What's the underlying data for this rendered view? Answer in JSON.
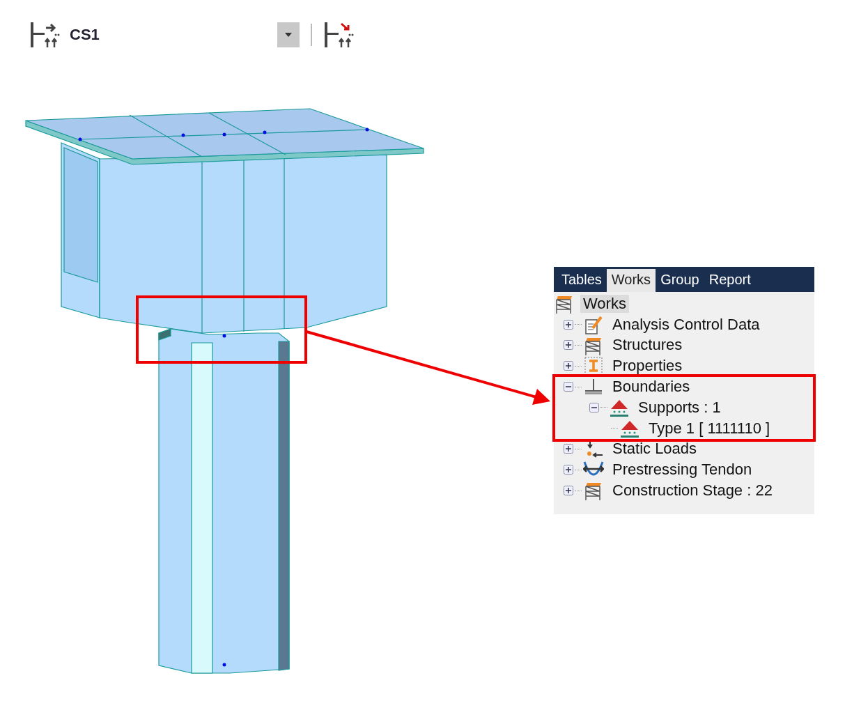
{
  "toolbar": {
    "stage": "CS1"
  },
  "panel": {
    "tabs": [
      {
        "label": "Tables",
        "selected": false
      },
      {
        "label": "Works",
        "selected": true
      },
      {
        "label": "Group",
        "selected": false
      },
      {
        "label": "Report",
        "selected": false
      }
    ],
    "tree": [
      {
        "label": "Works",
        "kind": "works",
        "selected": true,
        "children": [
          {
            "label": "Analysis Control Data",
            "kind": "analysis",
            "selected": false,
            "expanded": false
          },
          {
            "label": "Structures",
            "kind": "structures",
            "selected": false,
            "expanded": false
          },
          {
            "label": "Properties",
            "kind": "properties",
            "selected": false,
            "expanded": false
          },
          {
            "label": "Boundaries",
            "kind": "boundaries",
            "selected": false,
            "expanded": true,
            "children": [
              {
                "label": "Supports : 1",
                "kind": "supports",
                "selected": false,
                "expanded": true,
                "children": [
                  {
                    "label": "Type 1 [ 1111110 ]",
                    "kind": "supports",
                    "selected": false
                  }
                ]
              }
            ]
          },
          {
            "label": "Static Loads",
            "kind": "loads",
            "selected": false,
            "expanded": false
          },
          {
            "label": "Prestressing Tendon",
            "kind": "tendon",
            "selected": false,
            "expanded": false
          },
          {
            "label": "Construction Stage : 22",
            "kind": "stage",
            "selected": false,
            "expanded": false
          }
        ]
      }
    ]
  }
}
